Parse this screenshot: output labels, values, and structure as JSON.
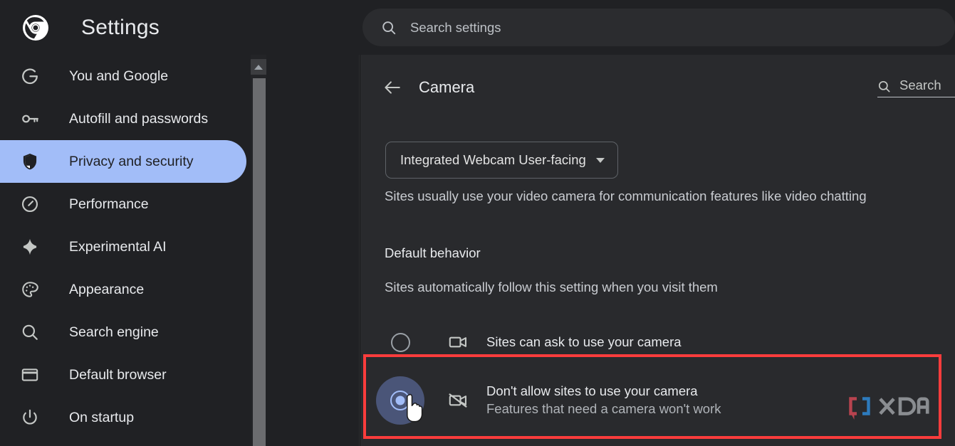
{
  "header": {
    "app_title": "Settings",
    "logo_icon": "chrome-logo-icon",
    "search": {
      "placeholder": "Search settings",
      "value": "",
      "icon": "search-icon"
    }
  },
  "sidebar": {
    "items": [
      {
        "label": "You and Google",
        "icon": "google-g-icon",
        "active": false
      },
      {
        "label": "Autofill and passwords",
        "icon": "key-icon",
        "active": false
      },
      {
        "label": "Privacy and security",
        "icon": "shield-icon",
        "active": true
      },
      {
        "label": "Performance",
        "icon": "speedometer-icon",
        "active": false
      },
      {
        "label": "Experimental AI",
        "icon": "sparkle-icon",
        "active": false
      },
      {
        "label": "Appearance",
        "icon": "palette-icon",
        "active": false
      },
      {
        "label": "Search engine",
        "icon": "search-icon",
        "active": false
      },
      {
        "label": "Default browser",
        "icon": "browser-window-icon",
        "active": false
      },
      {
        "label": "On startup",
        "icon": "power-icon",
        "active": false
      }
    ],
    "scrollbar": {
      "up_arrow_icon": "chevron-up-icon"
    }
  },
  "content": {
    "back_icon": "arrow-left-icon",
    "page_title": "Camera",
    "search": {
      "placeholder": "Search",
      "value": "",
      "icon": "search-icon"
    },
    "camera_select": {
      "value": "Integrated Webcam User-facing",
      "caret_icon": "chevron-down-icon"
    },
    "description": "Sites usually use your video camera for communication features like video chatting",
    "section_title": "Default behavior",
    "section_description": "Sites automatically follow this setting when you visit them",
    "options": [
      {
        "title": "Sites can ask to use your camera",
        "subtitle": "",
        "icon": "video-camera-icon",
        "selected": false
      },
      {
        "title": "Don't allow sites to use your camera",
        "subtitle": "Features that need a camera won't work",
        "icon": "video-camera-off-icon",
        "selected": true
      }
    ]
  },
  "overlay": {
    "highlight_color": "#fa3c3c",
    "cursor_icon": "hand-pointer-cursor",
    "watermark": {
      "text": "XDA",
      "bracket_left_color": "#b8434f",
      "bracket_right_color": "#2d7bbd",
      "text_color": "#8a8d91"
    }
  },
  "colors": {
    "sidebar_bg": "#202124",
    "content_bg": "#292a2d",
    "accent": "#a2bdf8",
    "text_primary": "#e8eaed",
    "text_secondary": "#c9ccd1"
  }
}
